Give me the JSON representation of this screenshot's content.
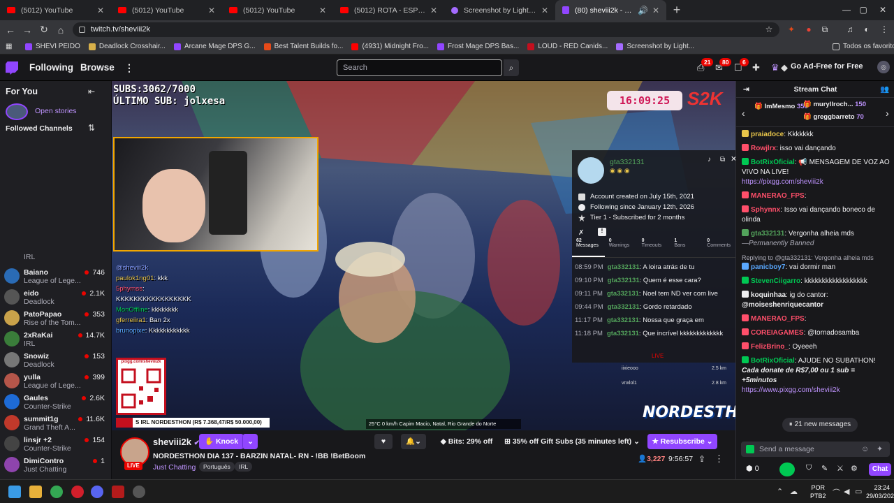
{
  "browser": {
    "tabs": [
      {
        "label": "(5012) YouTube",
        "icon": "youtube-icon"
      },
      {
        "label": "(5012) YouTube",
        "icon": "youtube-icon"
      },
      {
        "label": "(5012) YouTube",
        "icon": "youtube-icon"
      },
      {
        "label": "(5012) ROTA - ESPECIAL #17 - Y",
        "icon": "youtube-icon"
      },
      {
        "label": "Screenshot by Lightshot",
        "icon": "lightshot-icon"
      },
      {
        "label": "(80) sheviii2k - Twitch",
        "icon": "twitch-icon",
        "active": true
      }
    ],
    "url": "twitch.tv/sheviii2k",
    "bookmarks": [
      "SHEVI PEIDO",
      "Deadlock Crosshair...",
      "Arcane Mage DPS G...",
      "Best Talent Builds fo...",
      "(4931) Midnight Fro...",
      "Frost Mage DPS Bas...",
      "LOUD - RED Canids...",
      "Screenshot by Light..."
    ],
    "all_bookmarks": "Todos os favoritos"
  },
  "nav": {
    "following": "Following",
    "browse": "Browse",
    "search_placeholder": "Search",
    "badges": {
      "notifications": "21",
      "inbox": "80",
      "whispers": "6"
    },
    "ad_free": "Go Ad-Free for Free"
  },
  "sidebar": {
    "for_you": "For You",
    "open_stories": "Open stories",
    "followed_channels": "Followed Channels",
    "partial_game": "IRL",
    "channels": [
      {
        "name": "Baiano",
        "game": "League of Lege...",
        "viewers": "746",
        "color": "#2a6bb5"
      },
      {
        "name": "eido",
        "game": "Deadlock",
        "viewers": "2.1K",
        "color": "#555"
      },
      {
        "name": "PatoPapao",
        "game": "Rise of the Tom...",
        "viewers": "353",
        "color": "#c9a24a"
      },
      {
        "name": "2xRaKai",
        "game": "IRL",
        "viewers": "14.7K",
        "color": "#3a7d3a"
      },
      {
        "name": "Snowiz",
        "game": "Deadlock",
        "viewers": "153",
        "color": "#777"
      },
      {
        "name": "yulla",
        "game": "League of Lege...",
        "viewers": "399",
        "color": "#b5564a"
      },
      {
        "name": "Gaules",
        "game": "Counter-Strike",
        "viewers": "2.6K",
        "color": "#1e6bd6"
      },
      {
        "name": "summit1g",
        "game": "Grand Theft A...",
        "viewers": "11.6K",
        "color": "#c0392b"
      },
      {
        "name": "linsjr +2",
        "game": "Counter-Strike",
        "viewers": "154",
        "color": "#444"
      },
      {
        "name": "DimiContro",
        "game": "Just Chatting",
        "viewers": "1",
        "color": "#8e44ad"
      }
    ]
  },
  "video": {
    "subs": "SUBS:3062/7000",
    "last_sub": "ÚLTIMO SUB: jolxesa",
    "timer": "16:09:25",
    "logo": "S2K",
    "overlay_chat": [
      {
        "user": "@sheviii2k",
        "text": ""
      },
      {
        "user": "paulok1ng01",
        "text": ": kkk"
      },
      {
        "user": "5phymss",
        "text": ":"
      },
      {
        "user": "",
        "text": "KKKKKKKKKKKKKKKKK"
      },
      {
        "user": "MonOffline",
        "text": ": kkkkkkkk"
      },
      {
        "user": "gferreiira1",
        "text": ": Ban 2x"
      },
      {
        "user": "brunopixe",
        "text": ": Kkkkkkkkkkkk"
      }
    ],
    "qr_caption": "pixgg.com/sheviii2k",
    "ticker": "S IRL NORDESTHON (R$ 7.368,47/R$ 50.000,00)",
    "location": "25°C   0 km/h   Capim Macio, Natal, Rio Grande do Norte",
    "event_logo": "NORDESTHON",
    "distances": [
      {
        "name": "iixieooo",
        "km": "2.5 km"
      },
      {
        "name": "vnxlol1",
        "km": "2.8 km"
      }
    ]
  },
  "viewer_card": {
    "username": "gta332131",
    "account_created": "Account created on July 15th, 2021",
    "following_since": "Following since January 12th, 2026",
    "subscription": "Tier 1 - Subscribed for 2 months",
    "stats": [
      {
        "count": "62",
        "label": "Messages"
      },
      {
        "count": "0",
        "label": "Warnings"
      },
      {
        "count": "0",
        "label": "Timeouts"
      },
      {
        "count": "1",
        "label": "Bans"
      },
      {
        "count": "0",
        "label": "Comments"
      }
    ],
    "messages": [
      {
        "time": "08:59 PM",
        "text": "A loira atrás de tu"
      },
      {
        "time": "09:10 PM",
        "text": "Quem é esse cara?"
      },
      {
        "time": "09:11 PM",
        "text": "Noel tem ND ver com live"
      },
      {
        "time": "09:44 PM",
        "text": "Gordo retardado"
      },
      {
        "time": "11:17 PM",
        "text": "Nossa que graça em"
      },
      {
        "time": "11:18 PM",
        "text": "Que incrível kkkkkkkkkkkkk"
      }
    ],
    "live_label": "LIVE"
  },
  "stream_info": {
    "channel": "sheviii2k",
    "knock": "Knock",
    "live": "LIVE",
    "title": "NORDESTHON DIA 137 - BARZIN NATAL- RN - !BB !BetBoom",
    "category": "Just Chatting",
    "tags": [
      "Português",
      "IRL"
    ],
    "bits": "Bits: 29% off",
    "gift_subs": "35% off Gift Subs (35 minutes left)",
    "resubscribe": "Resubscribe",
    "viewers": "3,227",
    "uptime": "9:56:57"
  },
  "chat": {
    "header": "Stream Chat",
    "gifters": [
      {
        "name": "ImMesmo",
        "count": "350"
      },
      {
        "name": "muryllroch...",
        "count": "150"
      },
      {
        "name": "greggbarreto",
        "count": "70"
      }
    ],
    "lines": [
      {
        "user": "praiadoce",
        "text": ": Kkkkkkk",
        "color": "#e8c54a"
      },
      {
        "user": "Rowjlrx",
        "text": ": isso vai dançando",
        "color": "#ff4f6a"
      },
      {
        "user": "BotRixOficial",
        "text": ": 📢 MENSAGEM DE VOZ AO VIVO NA LIVE!",
        "color": "#00c853",
        "link": "https://pixgg.com/sheviii2k"
      },
      {
        "user": "MANERAO_FPS",
        "text": ":",
        "color": "#ff4f6a"
      },
      {
        "user": "Sphynnx",
        "text": ": Isso vai dançando boneco de olinda",
        "color": "#ff4f6a"
      },
      {
        "user": "gta332131",
        "text": ": Vergonha alheia mds",
        "color": "#53a35b",
        "note": "—Permanently Banned"
      },
      {
        "user": "panicboy7",
        "text": ": vai dormir man",
        "color": "#5aa9ff",
        "reply": "Replying to @gta332131: Vergonha alheia mds"
      },
      {
        "user": "StevenCiigarro",
        "text": ": kkkkkkkkkkkkkkkkkk",
        "color": "#00c853"
      },
      {
        "user": "koquinhaa",
        "text": ": ig do cantor:",
        "color": "#efeff1",
        "extra": "@moiseshenriquecantor"
      },
      {
        "user": "MANERAO_FPS",
        "text": ":",
        "color": "#ff4f6a"
      },
      {
        "user": "COREIAGAMES",
        "text": ": @tornadosamba",
        "color": "#ff4f6a"
      },
      {
        "user": "FelizBrino_",
        "text": ": Oyeeeh",
        "color": "#ff4f6a"
      },
      {
        "user": "BotRixOficial",
        "text": ": AJUDE NO SUBATHON!",
        "color": "#00c853",
        "italic": "Cada donate de R$7,00 ou 1 sub = +5minutos",
        "link": "https://www.pixgg.com/sheviii2k"
      }
    ],
    "new_messages": "21 new messages",
    "input_placeholder": "Send a message",
    "points": "0",
    "chat_button": "Chat"
  },
  "taskbar": {
    "lang": "POR",
    "layout": "PTB2",
    "time": "23:24",
    "date": "29/03/2026"
  }
}
